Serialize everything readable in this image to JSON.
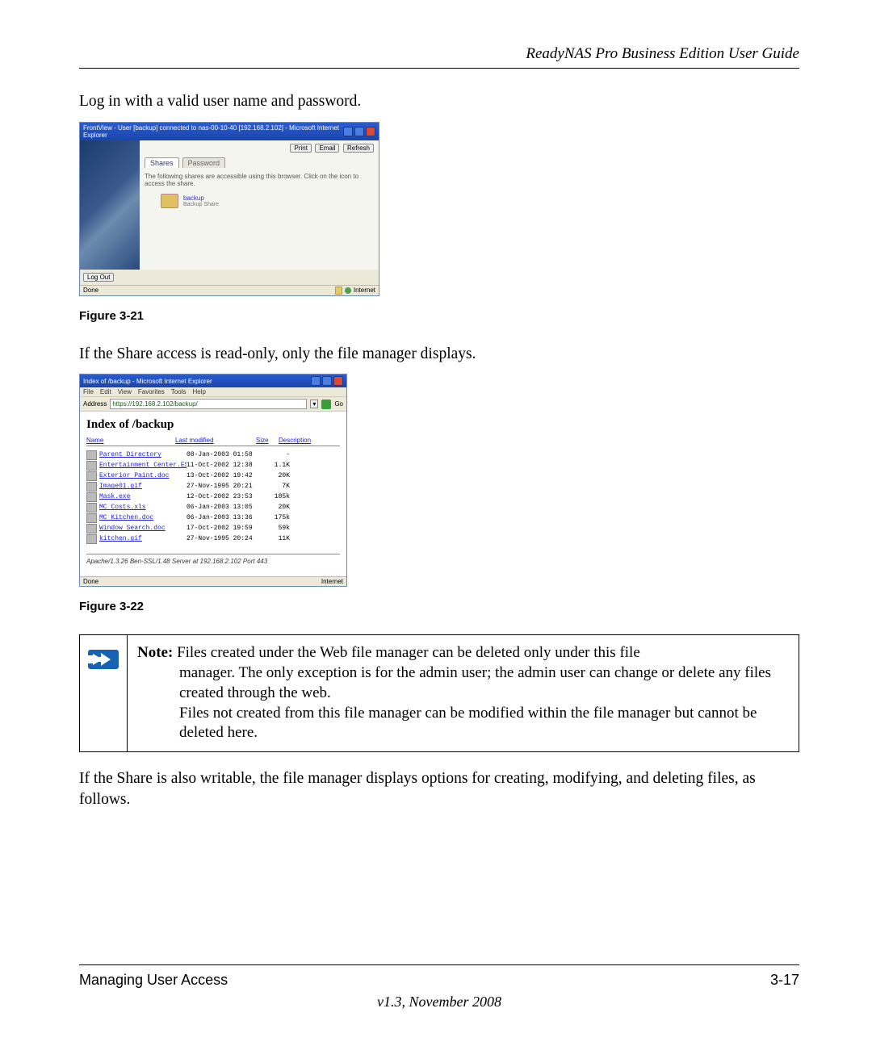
{
  "header_title": "ReadyNAS Pro Business Edition User Guide",
  "intro_para": "Log in with a valid user name and password.",
  "fig21": {
    "caption": "Figure 3-21",
    "window_title": "FrontView - User [backup] connected to nas-00-10-40 [192.168.2.102] - Microsoft Internet Explorer",
    "buttons": {
      "print": "Print",
      "email": "Email",
      "refresh": "Refresh"
    },
    "tabs": {
      "shares": "Shares",
      "password": "Password"
    },
    "message": "The following shares are accessible using this browser. Click on the icon to access the share.",
    "share": {
      "name": "backup",
      "desc": "Backup Share"
    },
    "logout": "Log Out",
    "status_done": "Done",
    "status_zone": "Internet"
  },
  "after_fig21": "If the Share access is read-only, only the file manager displays.",
  "fig22": {
    "caption": "Figure 3-22",
    "window_title": "Index of /backup - Microsoft Internet Explorer",
    "menu": [
      "File",
      "Edit",
      "View",
      "Favorites",
      "Tools",
      "Help"
    ],
    "address_label": "Address",
    "address_value": "https://192.168.2.102/backup/",
    "go": "Go",
    "heading": "Index of /backup",
    "cols": {
      "name": "Name",
      "mod": "Last modified",
      "size": "Size",
      "desc": "Description"
    },
    "rows": [
      {
        "name": "Parent Directory",
        "mod": "08-Jan-2003 01:58",
        "size": "-"
      },
      {
        "name": "Entertainment Center.ESD",
        "mod": "11-Oct-2002 12:38",
        "size": "1.1K"
      },
      {
        "name": "Exterior Paint.doc",
        "mod": "13-Oct-2002 19:42",
        "size": "20K"
      },
      {
        "name": "Image01.gif",
        "mod": "27-Nov-1995 20:21",
        "size": "7K"
      },
      {
        "name": "Mask.exe",
        "mod": "12-Oct-2002 23:53",
        "size": "185k"
      },
      {
        "name": "MC Costs.xls",
        "mod": "06-Jan-2003 13:05",
        "size": "20K"
      },
      {
        "name": "MC Kitchen.doc",
        "mod": "06-Jan-2003 13:36",
        "size": "175k"
      },
      {
        "name": "Window Search.doc",
        "mod": "17-Oct-2002 19:59",
        "size": "59k"
      },
      {
        "name": "kitchen.gif",
        "mod": "27-Nov-1995 20:24",
        "size": "11K"
      }
    ],
    "server_line": "Apache/1.3.26 Ben-SSL/1.48 Server at 192.168.2.102 Port 443",
    "status_done": "Done",
    "status_zone": "Internet"
  },
  "note": {
    "label": "Note:",
    "line1": " Files created under the Web file manager can be deleted only under this file",
    "line2": "manager. The only exception is for the admin user; the admin user can change or delete any files created through the web.",
    "line3": "Files not created from this file manager can be modified within the file manager but cannot be deleted here."
  },
  "after_note": "If the Share is also writable, the file manager displays options for creating, modifying, and deleting files, as follows.",
  "footer": {
    "left": "Managing User Access",
    "right": "3-17",
    "version": "v1.3, November 2008"
  }
}
